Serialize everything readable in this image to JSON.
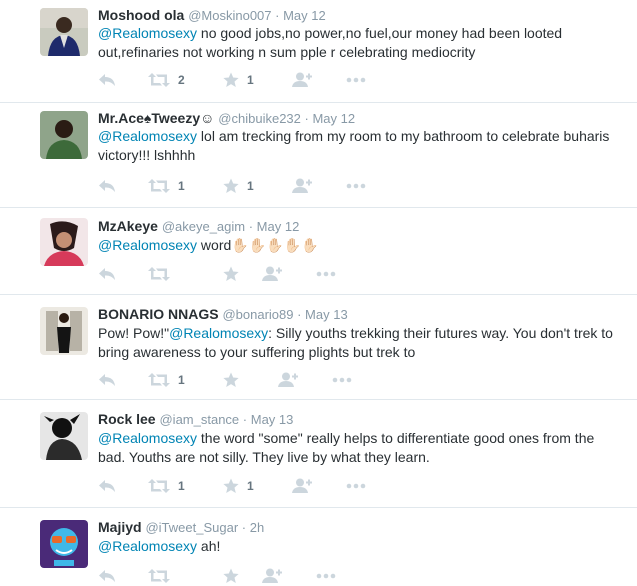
{
  "tweets": [
    {
      "name": "Moshood ola",
      "handle": "@Moskino007",
      "date": "May 12",
      "mention": "@Realomosexy",
      "text": "  no good jobs,no power,no fuel,our money had been looted out,refinaries not working n sum pple r celebrating mediocrity",
      "retweets": "2",
      "favorites": "1"
    },
    {
      "name": "Mr.Ace♠Tweezy☺",
      "handle": "@chibuike232",
      "date": "May 12",
      "mention": "@Realomosexy",
      "text": " lol am trecking from my room to my bathroom to celebrate buharis victory!!! lshhhh",
      "retweets": "1",
      "favorites": "1"
    },
    {
      "name": "MzAkeye",
      "handle": "@akeye_agim",
      "date": "May 12",
      "mention": "@Realomosexy",
      "text": " word✋🏻✋🏻✋🏻✋🏻✋🏻",
      "retweets": "",
      "favorites": ""
    },
    {
      "name": "BONARIO NNAGS",
      "handle": "@bonario89",
      "date": "May 13",
      "prefix": "Pow! Pow!\"",
      "mention": "@Realomosexy",
      "text": ": Silly youths trekking their futures way. You don't trek to bring awareness to your suffering plights but trek to",
      "retweets": "1",
      "favorites": ""
    },
    {
      "name": "Rock lee",
      "handle": "@iam_stance",
      "date": "May 13",
      "mention": "@Realomosexy",
      "text": " the word \"some\" really helps to differentiate good ones from the bad. Youths are not silly. They live by what they learn.",
      "retweets": "1",
      "favorites": "1"
    },
    {
      "name": "Majiyd",
      "handle": "@iTweet_Sugar",
      "date": "2h",
      "mention": "@Realomosexy",
      "text": " ah!",
      "retweets": "",
      "favorites": ""
    }
  ],
  "date_separator": " · ",
  "colors": {
    "link": "#0084b4",
    "meta": "#8899a6",
    "icon": "#ccd6dd",
    "divider": "#e1e8ed"
  },
  "icons": [
    "reply-icon",
    "retweet-icon",
    "favorite-icon",
    "follow-icon",
    "more-icon"
  ]
}
